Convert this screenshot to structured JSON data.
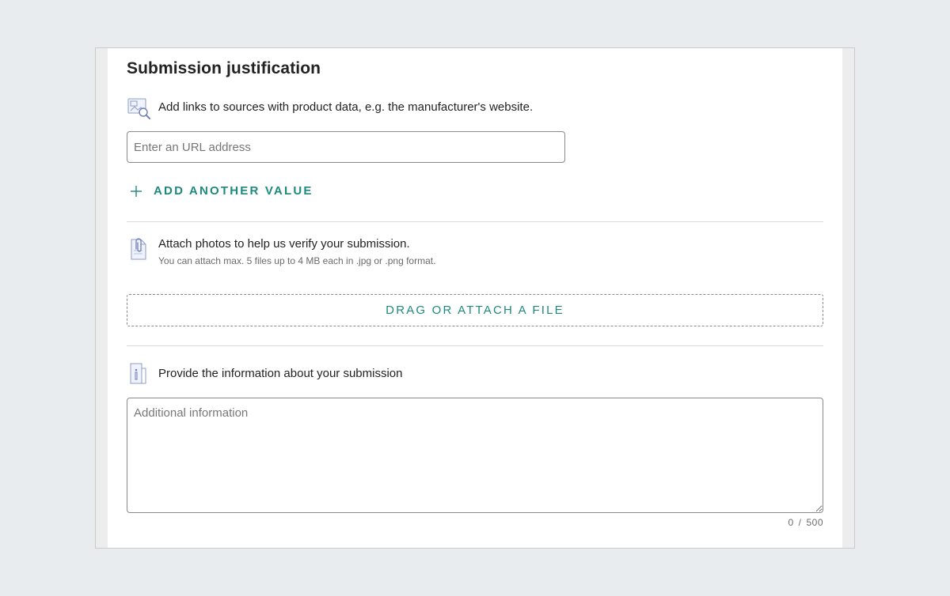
{
  "section": {
    "title": "Submission justification"
  },
  "links": {
    "description": "Add links to sources with product data, e.g. the manufacturer's website.",
    "icon": "image-search-icon",
    "url_placeholder": "Enter an URL address",
    "url_value": "",
    "add_label": "ADD ANOTHER VALUE"
  },
  "photos": {
    "icon": "paperclip-document-icon",
    "title": "Attach photos to help us verify your submission.",
    "hint": "You can attach max. 5 files up to 4 MB each in .jpg or .png format.",
    "drop_label": "DRAG OR ATTACH A FILE"
  },
  "info": {
    "icon": "info-document-icon",
    "title": "Provide the information about your submission",
    "placeholder": "Additional information",
    "value": "",
    "count": "0",
    "separator": "/",
    "max": "500"
  },
  "colors": {
    "accent": "#1e8a7d",
    "background": "#e9ecef",
    "panel": "#ffffff",
    "border": "#8a8a8a",
    "divider": "#dcdcdc"
  }
}
